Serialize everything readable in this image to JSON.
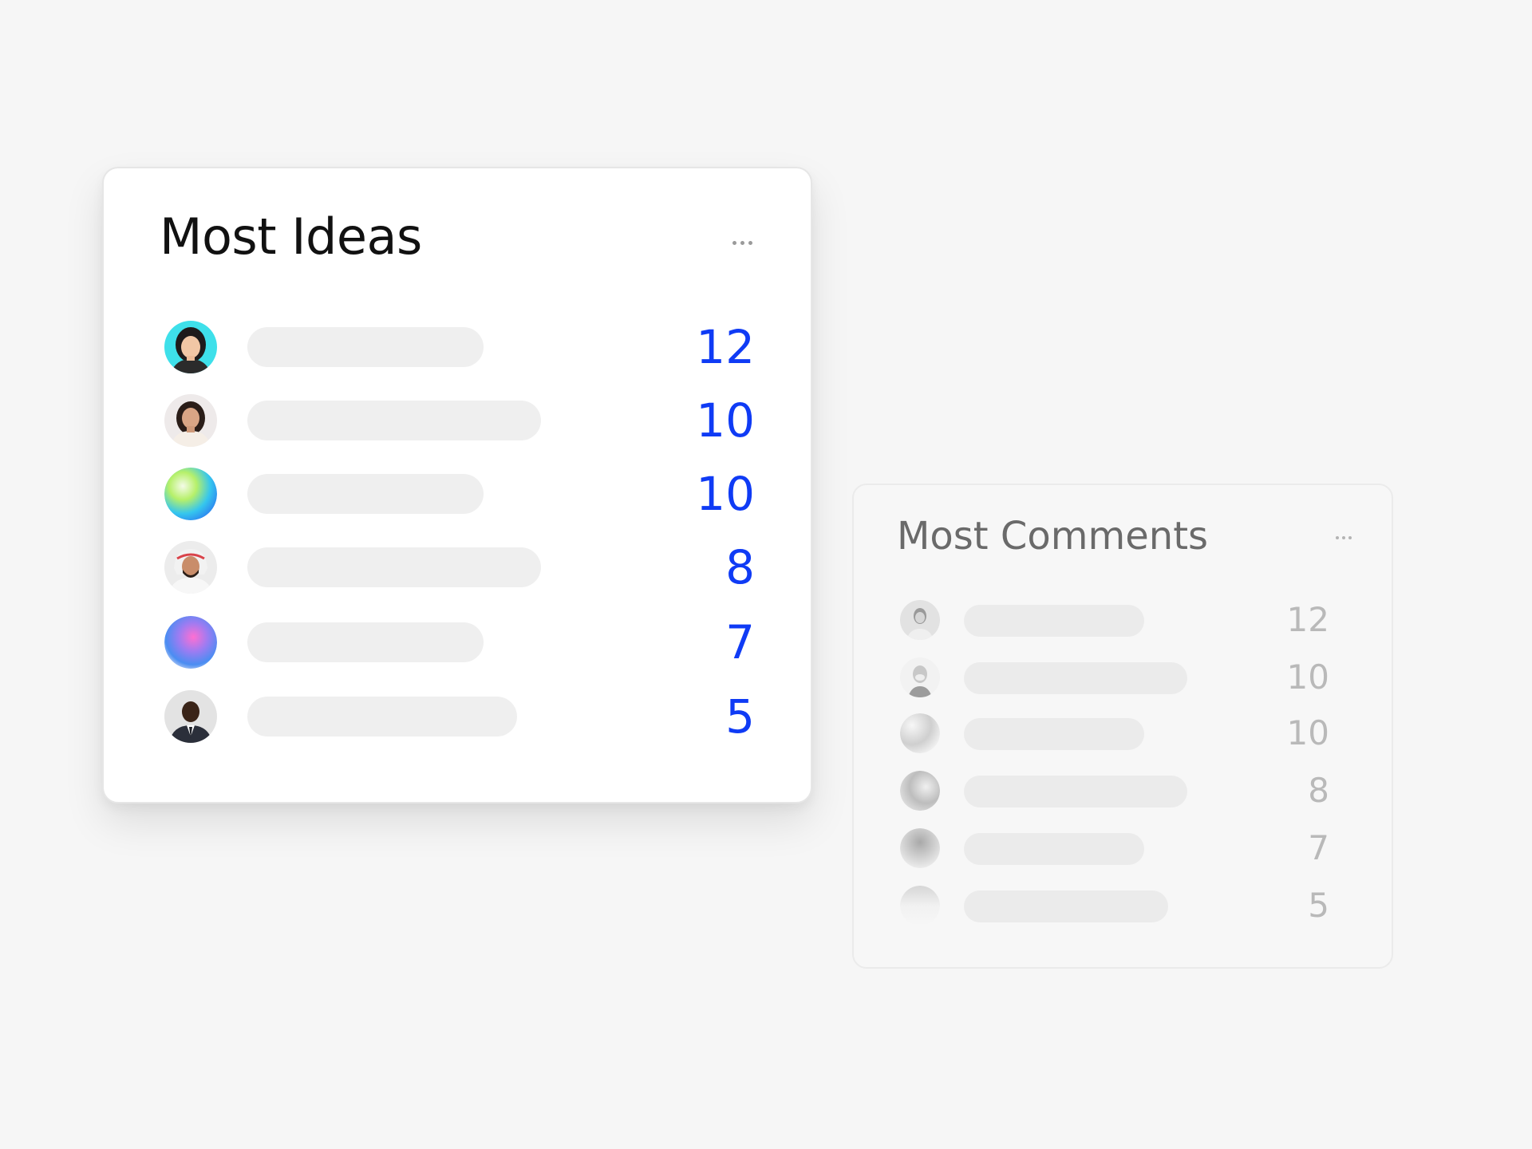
{
  "most_ideas": {
    "title": "Most Ideas",
    "menu_icon": "more-horizontal-icon",
    "accent_color": "#0f3bf5",
    "rows": [
      {
        "count": "12",
        "avatar": "person-photo-avatar"
      },
      {
        "count": "10",
        "avatar": "person-photo-avatar"
      },
      {
        "count": "10",
        "avatar": "gradient-avatar"
      },
      {
        "count": "8",
        "avatar": "person-photo-avatar"
      },
      {
        "count": "7",
        "avatar": "gradient-avatar"
      },
      {
        "count": "5",
        "avatar": "person-photo-avatar"
      }
    ]
  },
  "most_comments": {
    "title": "Most Comments",
    "menu_icon": "more-horizontal-icon",
    "rows": [
      {
        "count": "12",
        "avatar": "person-photo-avatar"
      },
      {
        "count": "10",
        "avatar": "person-photo-avatar"
      },
      {
        "count": "10",
        "avatar": "gradient-avatar"
      },
      {
        "count": "8",
        "avatar": "gradient-avatar"
      },
      {
        "count": "7",
        "avatar": "gradient-avatar"
      },
      {
        "count": "5",
        "avatar": "gradient-avatar"
      }
    ]
  }
}
